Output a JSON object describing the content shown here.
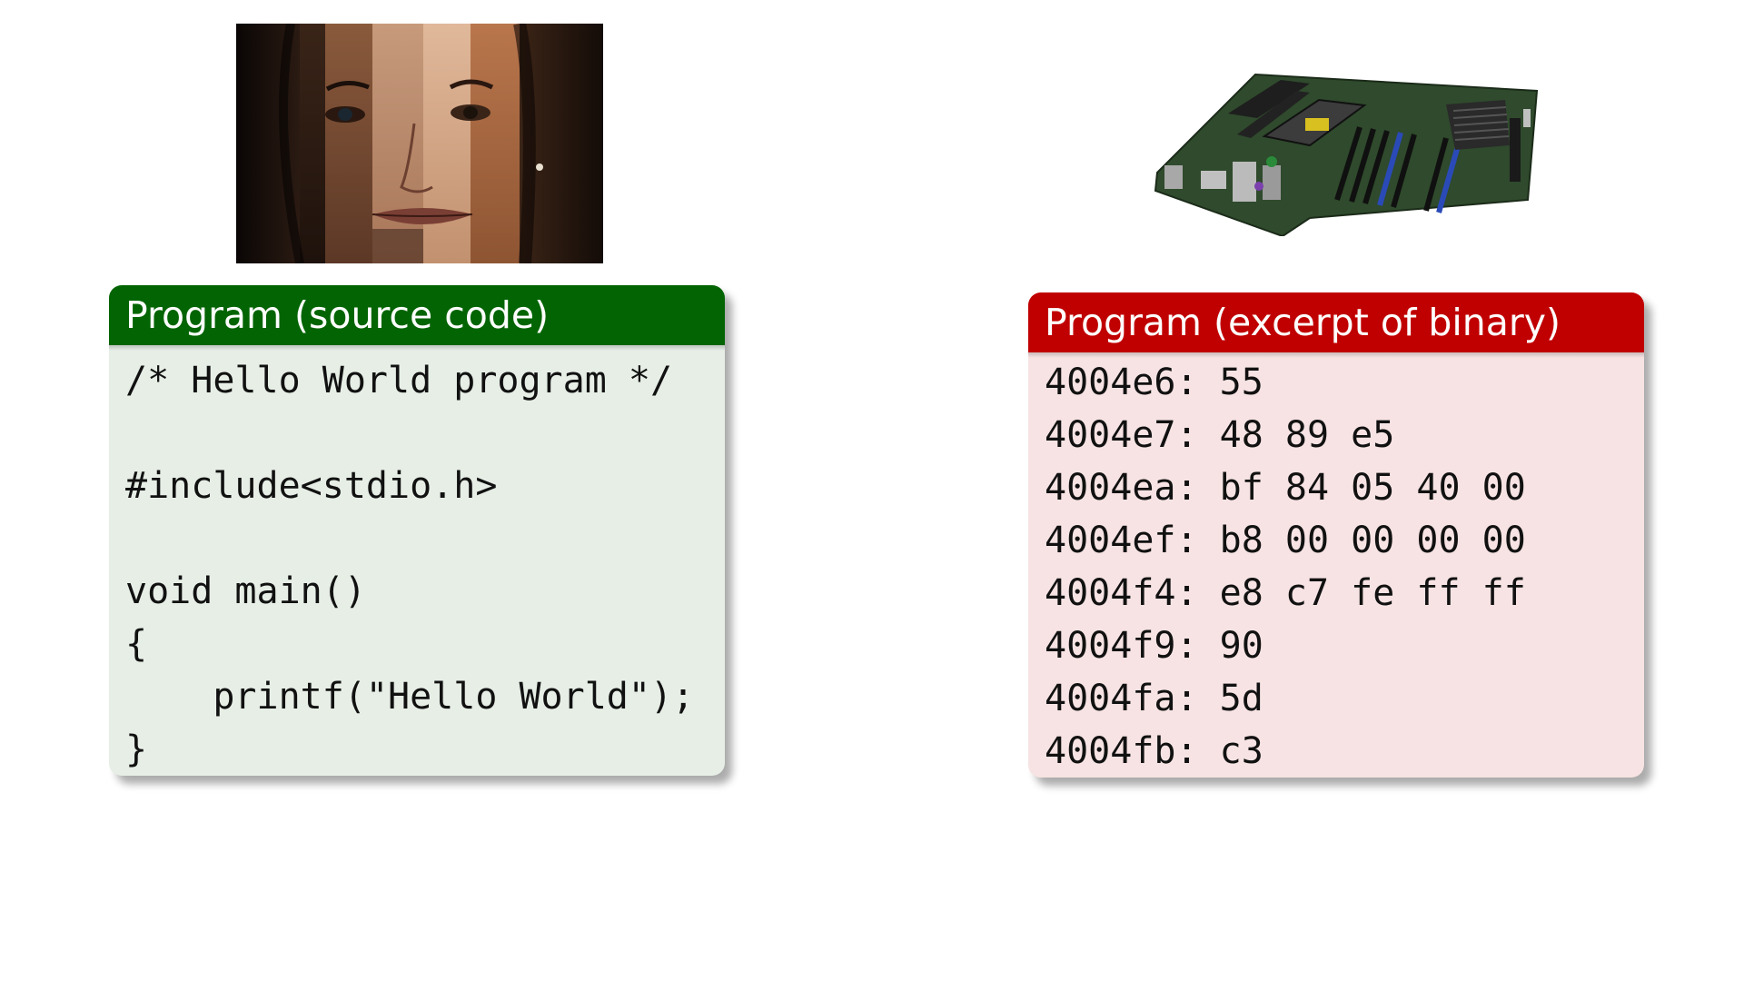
{
  "images": {
    "faces": {
      "icon": "collage-of-human-faces"
    },
    "board": {
      "icon": "computer-motherboard"
    }
  },
  "source_block": {
    "title": "Program (source code)",
    "accent_color": "#036403",
    "body_color": "#e6eee6",
    "lines": [
      "/* Hello World program */",
      "",
      "#include<stdio.h>",
      "",
      "void main()",
      "{",
      "    printf(\"Hello World\");",
      "}"
    ]
  },
  "binary_block": {
    "title": "Program (excerpt of binary)",
    "accent_color": "#c00000",
    "body_color": "#f7e3e3",
    "lines": [
      "4004e6: 55",
      "4004e7: 48 89 e5",
      "4004ea: bf 84 05 40 00",
      "4004ef: b8 00 00 00 00",
      "4004f4: e8 c7 fe ff ff",
      "4004f9: 90",
      "4004fa: 5d",
      "4004fb: c3"
    ]
  }
}
